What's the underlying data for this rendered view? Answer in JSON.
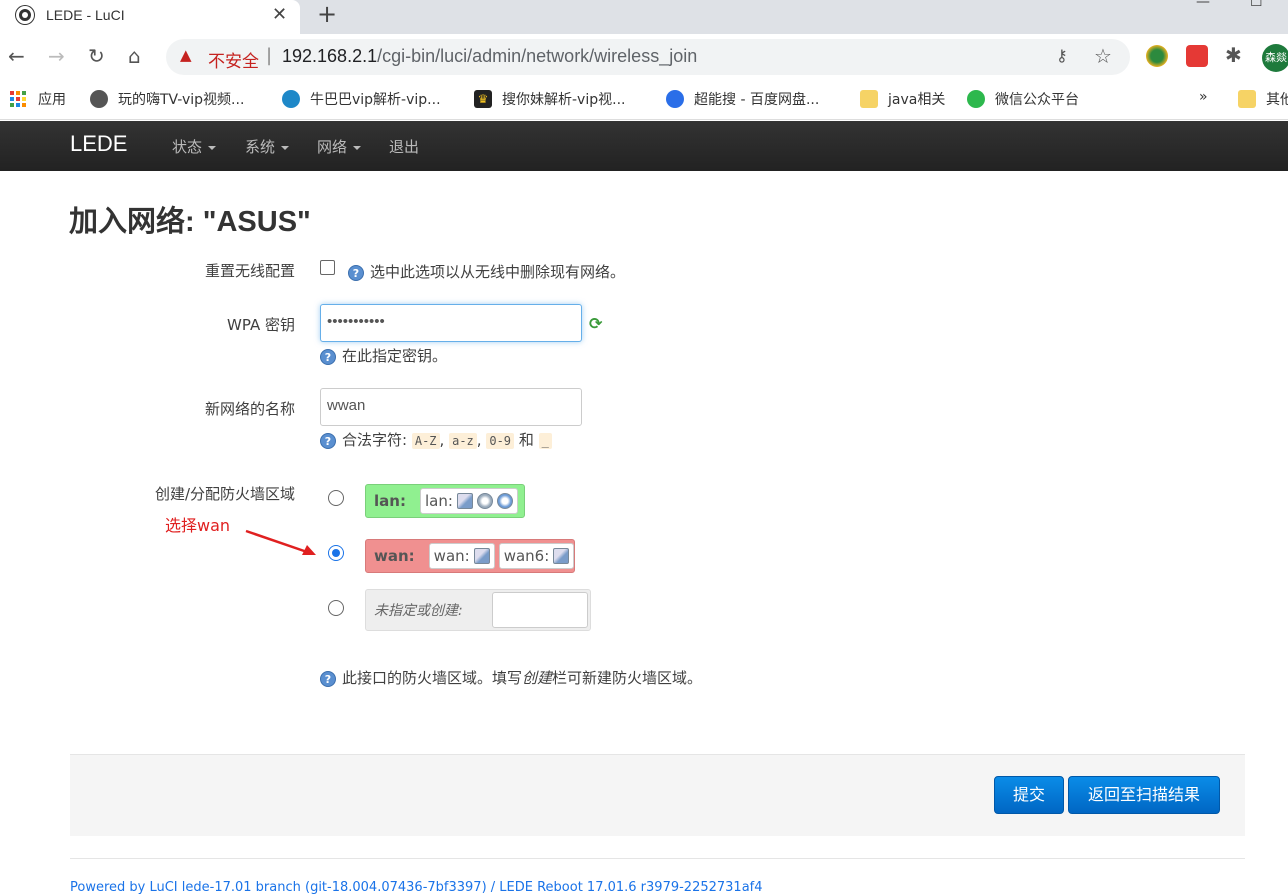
{
  "browser": {
    "tab_title": "LEDE - LuCI",
    "security_label": "不安全",
    "url_host": "192.168.2.1",
    "url_path": "/cgi-bin/luci/admin/network/wireless_join",
    "profile_text": "森燚",
    "bookmarks": [
      {
        "label": "应用"
      },
      {
        "label": "玩的嗨TV-vip视频..."
      },
      {
        "label": "牛巴巴vip解析-vip..."
      },
      {
        "label": "搜你妹解析-vip视..."
      },
      {
        "label": "超能搜 - 百度网盘..."
      },
      {
        "label": "java相关"
      },
      {
        "label": "微信公众平台"
      },
      {
        "label": "其他"
      }
    ],
    "more_label": "»"
  },
  "nav": {
    "brand": "LEDE",
    "menus": [
      "状态",
      "系统",
      "网络",
      "退出"
    ]
  },
  "form": {
    "title": "加入网络: \"ASUS\"",
    "reset": {
      "label": "重置无线配置",
      "checked": false,
      "help": "选中此选项以从无线中删除现有网络。"
    },
    "wpa": {
      "label": "WPA 密钥",
      "value": "•••••••••••",
      "help": "在此指定密钥。"
    },
    "netname": {
      "label": "新网络的名称",
      "value": "wwan",
      "help_prefix": "合法字符:",
      "tokens": [
        "A-Z",
        "a-z",
        "0-9",
        "_"
      ],
      "sep": ",",
      "and": "和"
    },
    "zone": {
      "label": "创建/分配防火墙区域",
      "lan": {
        "name": "lan:",
        "ifaces": [
          "lan:"
        ]
      },
      "wan": {
        "name": "wan:",
        "ifaces": [
          "wan:",
          "wan6:"
        ]
      },
      "unspecified": "未指定或创建:",
      "selected": "wan",
      "help_a": "此接口的防火墙区域。填写",
      "help_em": "创建",
      "help_b": "栏可新建防火墙区域。"
    },
    "annotation": "选择wan",
    "submit": "提交",
    "back": "返回至扫描结果"
  },
  "footer": {
    "powered": "Powered by LuCI lede-17.01 branch (git-18.004.07436-7bf3397) / LEDE Reboot 17.01.6 r3979-2252731af4"
  },
  "colors": {
    "lan_zone": "#90f090",
    "wan_zone": "#f09090",
    "button": "#0074cc",
    "annotation": "#e02020"
  }
}
